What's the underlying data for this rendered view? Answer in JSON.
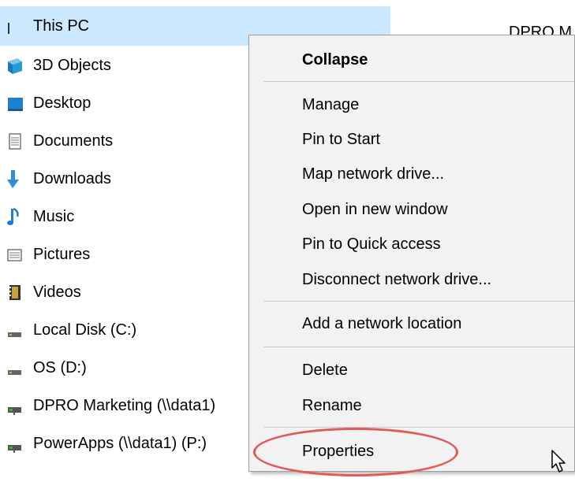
{
  "nav": {
    "selected": "This PC",
    "items": [
      {
        "label": "This PC",
        "icon": "computer-icon"
      },
      {
        "label": "3D Objects",
        "icon": "3d-objects-icon"
      },
      {
        "label": "Desktop",
        "icon": "desktop-icon"
      },
      {
        "label": "Documents",
        "icon": "documents-icon"
      },
      {
        "label": "Downloads",
        "icon": "downloads-icon"
      },
      {
        "label": "Music",
        "icon": "music-icon"
      },
      {
        "label": "Pictures",
        "icon": "pictures-icon"
      },
      {
        "label": "Videos",
        "icon": "videos-icon"
      },
      {
        "label": "Local Disk (C:)",
        "icon": "local-disk-icon"
      },
      {
        "label": "OS (D:)",
        "icon": "local-disk-icon"
      },
      {
        "label": "DPRO Marketing (\\\\data1)",
        "icon": "network-drive-icon"
      },
      {
        "label": "PowerApps (\\\\data1) (P:)",
        "icon": "network-drive-icon"
      }
    ]
  },
  "right_peek": "DPRO M",
  "context_menu": {
    "items": [
      {
        "label": "Collapse",
        "bold": true
      },
      {
        "label": "Manage"
      },
      {
        "label": "Pin to Start"
      },
      {
        "label": "Map network drive..."
      },
      {
        "label": "Open in new window"
      },
      {
        "label": "Pin to Quick access"
      },
      {
        "label": "Disconnect network drive..."
      },
      {
        "label": "Add a network location"
      },
      {
        "label": "Delete"
      },
      {
        "label": "Rename"
      },
      {
        "label": "Properties"
      }
    ]
  },
  "colors": {
    "selection": "#cce8ff",
    "menu_bg": "#f2f2f2",
    "highlight_ring": "#e05a5a"
  }
}
